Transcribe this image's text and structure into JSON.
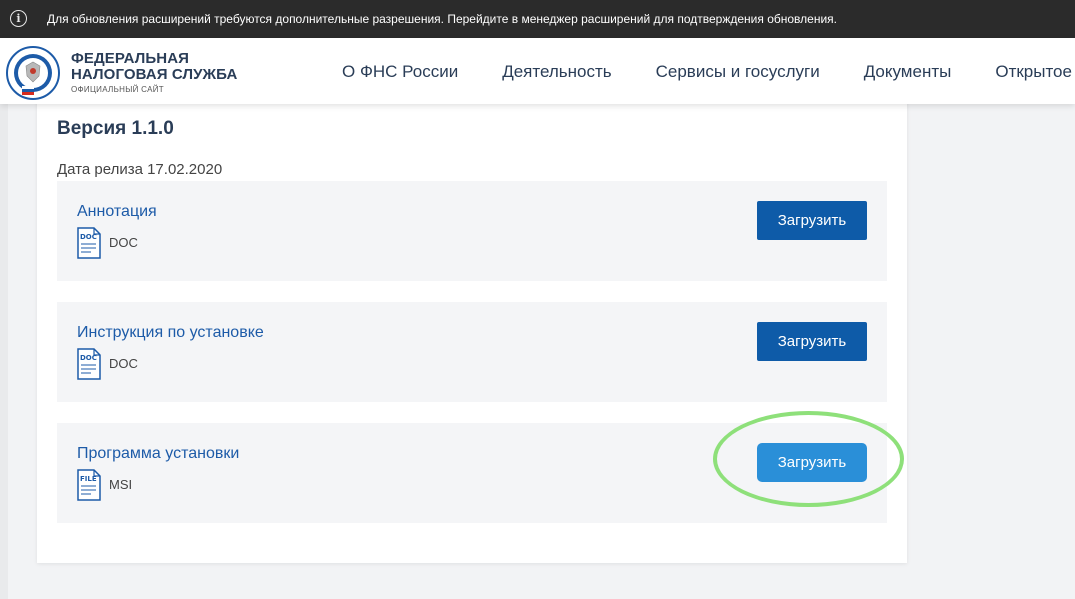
{
  "infobar": {
    "icon": "info-icon",
    "icon_glyph": "i",
    "text": "Для обновления расширений требуются дополнительные разрешения. Перейдите в менеджер расширений для подтверждения обновления."
  },
  "header": {
    "logo_line1": "ФЕДЕРАЛЬНАЯ",
    "logo_line2": "НАЛОГОВАЯ СЛУЖБА",
    "logo_sub": "ОФИЦИАЛЬНЫЙ САЙТ",
    "nav": [
      "О ФНС России",
      "Деятельность",
      "Сервисы и госуслуги",
      "Документы",
      "Открытое в"
    ]
  },
  "release": {
    "version": "Версия 1.1.0",
    "date": "Дата релиза 17.02.2020",
    "files": [
      {
        "title": "Аннотация",
        "icon_label": "DOC",
        "type": "DOC",
        "button": "Загрузить"
      },
      {
        "title": "Инструкция по установке",
        "icon_label": "DOC",
        "type": "DOC",
        "button": "Загрузить"
      },
      {
        "title": "Программа установки",
        "icon_label": "FILE",
        "type": "MSI",
        "button": "Загрузить"
      }
    ]
  },
  "colors": {
    "brand_blue": "#0e5ba8",
    "active_button": "#2a8fd8",
    "link": "#1d5ba8",
    "highlight": "#8ee07a"
  }
}
